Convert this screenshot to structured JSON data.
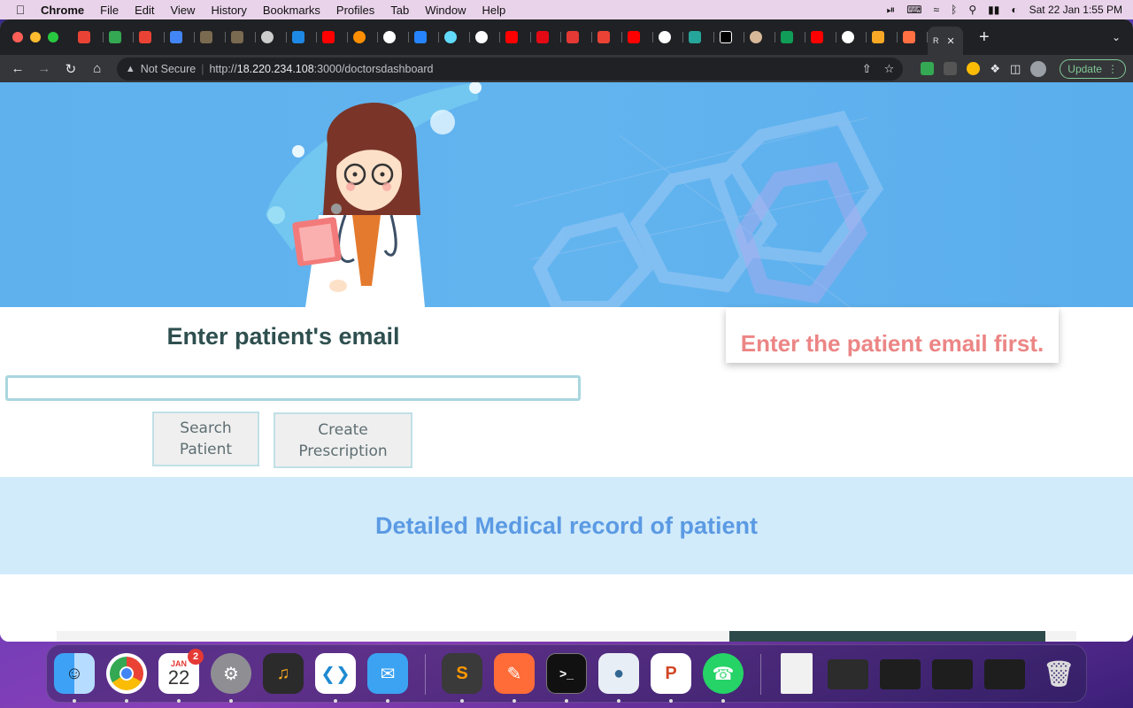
{
  "menubar": {
    "app_name": "Chrome",
    "items": [
      "File",
      "Edit",
      "View",
      "History",
      "Bookmarks",
      "Profiles",
      "Tab",
      "Window",
      "Help"
    ],
    "datetime": "Sat 22 Jan  1:55 PM"
  },
  "browser": {
    "active_tab_label": "R",
    "security_label": "Not Secure",
    "url_scheme": "http://",
    "url_host": "18.220.234.108",
    "url_rest": ":3000/doctorsdashboard",
    "update_label": "Update"
  },
  "page": {
    "email_heading": "Enter patient's email",
    "email_input_value": "",
    "search_button_label": "Search Patient",
    "create_button_label": "Create Prescription",
    "alert_message": "Enter the patient email first.",
    "record_heading": "Detailed Medical record of patient"
  },
  "dock": {
    "calendar_month": "JAN",
    "calendar_day": "22",
    "calendar_badge": "2"
  },
  "colors": {
    "hero_bg": "#5fb1ee",
    "heading_dark": "#2f4f4f",
    "alert_text": "#ec8585",
    "record_text": "#5b9ae3",
    "record_band_bg": "#d1ebfb"
  }
}
